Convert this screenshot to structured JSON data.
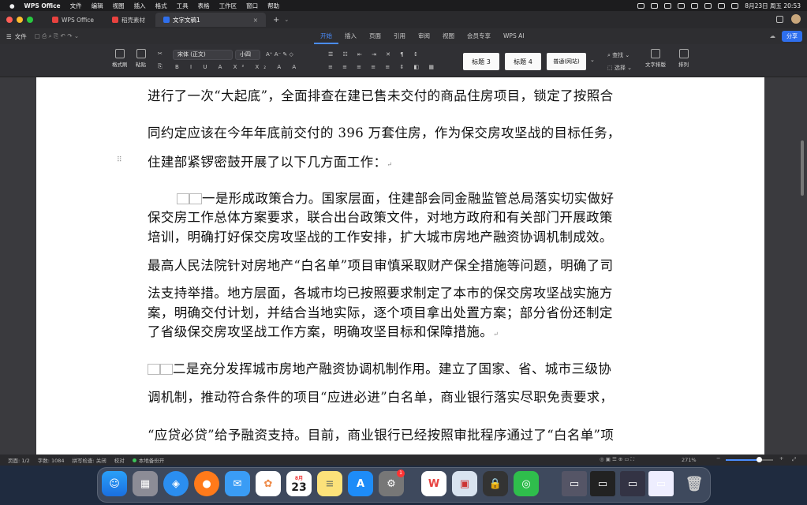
{
  "menubar": {
    "apple": "",
    "app_name": "WPS Office",
    "items": [
      "文件",
      "编辑",
      "视图",
      "插入",
      "格式",
      "工具",
      "表格",
      "工作区",
      "窗口",
      "帮助"
    ],
    "datetime": "8月23日 周五 20:53"
  },
  "tabs": [
    {
      "label": "WPS Office",
      "color": "#e8423f"
    },
    {
      "label": "稻壳素材",
      "color": "#e8423f"
    },
    {
      "label": "文字文稿1",
      "color": "#2f6fed"
    }
  ],
  "menurow": {
    "file_menu": "文件",
    "ribbon_tabs": [
      "开始",
      "插入",
      "页面",
      "引用",
      "审阅",
      "视图",
      "会员专享",
      "WPS AI"
    ],
    "active_tab": "开始",
    "share": "分享"
  },
  "toolbar": {
    "format_painter": "格式刷",
    "paste": "粘贴",
    "font_name": "宋体 (正文)",
    "font_size": "小四",
    "styles": [
      "标题 3",
      "标题 4",
      "普通(网站)"
    ],
    "find_replace": "查找",
    "select": "选择",
    "text_layout": "文字排版",
    "arrange": "排列"
  },
  "document": {
    "lines": [
      "进行了一次“大起底”，全面排查在建已售未交付的商品住房项目，锁定了按照合",
      "同约定应该在今年年底前交付的 396 万套住房，作为保交房攻坚战的目标任务，",
      "住建部紧锣密鼓开展了以下几方面工作：",
      "一是形成政策合力。国家层面，住建部会同金融监管总局落实切实做好",
      "保交房工作总体方案要求，联合出台政策文件，对地方政府和有关部门开展政策",
      "培训，明确打好保交房攻坚战的工作安排，扩大城市房地产融资协调机制成效。",
      "最高人民法院针对房地产“白名单”项目审慎采取财产保全措施等问题，明确了司",
      "法支持举措。地方层面，各城市均已按照要求制定了本市的保交房攻坚战实施方",
      "案，明确交付计划，并结合当地实际，逐个项目拿出处置方案；部分省份还制定",
      "了省级保交房攻坚战工作方案，明确攻坚目标和保障措施。",
      "二是充分发挥城市房地产融资协调机制作用。建立了国家、省、城市三级协",
      "调机制，推动符合条件的项目“应进必进”白名单，商业银行落实尽职免责要求，",
      "“应贷必贷”给予融资支持。目前，商业银行已经按照审批程序通过了“白名单”项"
    ]
  },
  "status": {
    "page": "页面: 1/2",
    "words": "字数: 1084",
    "spellcheck": "拼写检查: 关闭",
    "proofread": "校对",
    "backup": "本地备份开",
    "zoom": "271%",
    "zoom_level": 0.7
  },
  "dock": {
    "calendar_month": "8月",
    "calendar_day": "23",
    "settings_badge": "1",
    "apps": [
      "finder",
      "launchpad",
      "safari",
      "firefox",
      "mail",
      "photos",
      "calendar",
      "notes",
      "app-store",
      "system-settings",
      "wps",
      "remote-desktop",
      "keychain",
      "wechat",
      "trash"
    ]
  }
}
